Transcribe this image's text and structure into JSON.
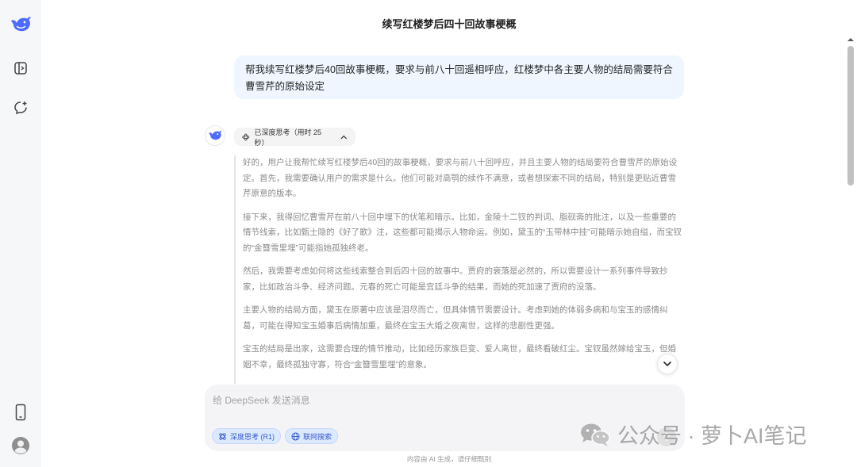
{
  "conversation_title": "续写红楼梦后四十回故事梗概",
  "user_message": "帮我续写红楼梦后40回故事梗概，要求与前八十回遥相呼应，红楼梦中各主要人物的结局需要符合曹雪芹的原始设定",
  "thinking_chip": {
    "label": "已深度思考（用时 25 秒）"
  },
  "thinking_paragraphs": [
    "好的，用户让我帮忙续写红楼梦后40回的故事梗概，要求与前八十回呼应，并且主要人物的结局要符合曹雪芹的原始设定。首先，我需要确认用户的需求是什么。他们可能对高鹗的续作不满意，或者想探索不同的结局，特别是更贴近曹雪芹原意的版本。",
    "接下来，我得回忆曹雪芹在前八十回中埋下的伏笔和暗示。比如，金陵十二钗的判词、脂砚斋的批注，以及一些重要的情节线索，比如甄士隐的《好了歌》注，这些都可能揭示人物命运。例如，黛玉的“玉带林中挂”可能暗示她自缢，而宝钗的“金簪雪里埋”可能指她孤独终老。",
    "然后，我需要考虑如何将这些线索整合到后四十回的故事中。贾府的衰落是必然的，所以需要设计一系列事件导致抄家，比如政治斗争、经济问题。元春的死亡可能是宫廷斗争的结果，而她的死加速了贾府的没落。",
    "主要人物的结局方面，黛玉在原著中应该是泪尽而亡，但具体情节需要设计。考虑到她的体弱多病和与宝玉的感情纠葛，可能在得知宝玉婚事后病情加重，最终在宝玉大婚之夜离世，这样的悲剧性更强。",
    "宝玉的结局是出家，这需要合理的情节推动，比如经历家族巨变、爱人离世，最终看破红尘。宝钗虽然嫁给宝玉，但婚姻不幸，最终孤独守寡，符合“金簪雪里埋”的意象。"
  ],
  "input": {
    "placeholder": "给 DeepSeek 发送消息"
  },
  "chips": {
    "deep_think": "深度思考 (R1)",
    "web_search": "联网搜索"
  },
  "footnote": "内容由 AI 生成，请仔细甄别",
  "watermark": "公众号 · 萝卜AI笔记",
  "colors": {
    "brand": "#4d6bfe",
    "user_bubble": "#eff6ff",
    "chip_bg": "#dbeafe"
  }
}
